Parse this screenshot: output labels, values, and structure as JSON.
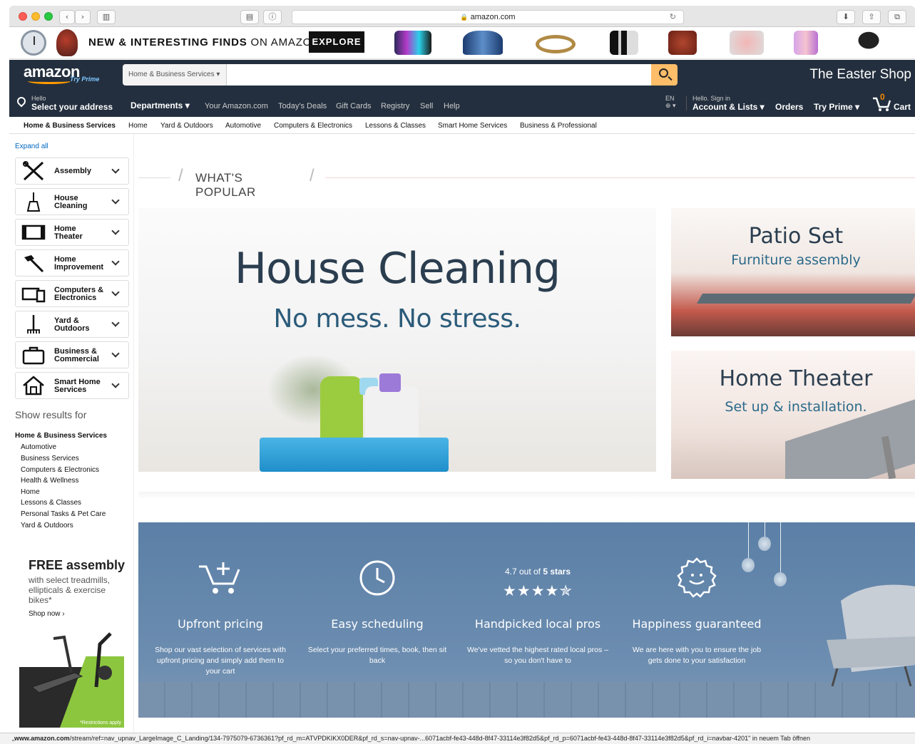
{
  "browser": {
    "url": "amazon.com",
    "lock_icon": "lock-icon",
    "status_url_host": "www.amazon.com",
    "status_url_rest": "/stream/ref=nav_upnav_LargeImage_C_Landing/134-7975079-6736361?pf_rd_m=ATVPDKIKX0DER&pf_rd_s=nav-upnav-...6071acbf-fe43-448d-8f47-33114e3f82d5&pf_rd_p=6071acbf-fe43-448d-8f47-33114e3f82d5&pf_rd_i=navbar-4201\" in neuem Tab öffnen",
    "status_prefix": "„"
  },
  "promo": {
    "text_bold": "NEW & INTERESTING FINDS",
    "text_rest": " ON AMAZON",
    "explore": "EXPLORE"
  },
  "header": {
    "logo": "amazon",
    "try_prime_small": "Try Prime",
    "search_department": "Home & Business Services ▾",
    "search_placeholder": "",
    "easter_shop": "The Easter Shop",
    "hello": "Hello",
    "select_address": "Select your address",
    "departments": "Departments ▾",
    "links": [
      "Your Amazon.com",
      "Today's Deals",
      "Gift Cards",
      "Registry",
      "Sell",
      "Help"
    ],
    "lang": "EN",
    "globe": "⊕ ▾",
    "signin_hello": "Hello. Sign in",
    "account_lists": "Account & Lists ▾",
    "orders": "Orders",
    "try_prime": "Try Prime ▾",
    "cart_count": "0",
    "cart": "Cart"
  },
  "subnav": [
    "Home & Business Services",
    "Home",
    "Yard & Outdoors",
    "Automotive",
    "Computers & Electronics",
    "Lessons & Classes",
    "Smart Home Services",
    "Business & Professional"
  ],
  "sidebar": {
    "expand_all": "Expand all",
    "categories": [
      {
        "label1": "Assembly",
        "label2": "",
        "icon": "tools-icon"
      },
      {
        "label1": "House",
        "label2": "Cleaning",
        "icon": "broom-icon"
      },
      {
        "label1": "Home",
        "label2": "Theater",
        "icon": "tv-icon"
      },
      {
        "label1": "Home",
        "label2": "Improvement",
        "icon": "hammer-icon"
      },
      {
        "label1": "Computers &",
        "label2": "Electronics",
        "icon": "devices-icon"
      },
      {
        "label1": "Yard &",
        "label2": "Outdoors",
        "icon": "rake-icon"
      },
      {
        "label1": "Business &",
        "label2": "Commercial",
        "icon": "briefcase-icon"
      },
      {
        "label1": "Smart Home",
        "label2": "Services",
        "icon": "smart-home-icon"
      }
    ],
    "show_results": "Show results for",
    "results_head": "Home & Business Services",
    "results": [
      "Automotive",
      "Business Services",
      "Computers & Electronics",
      "Health & Wellness",
      "Home",
      "Lessons & Classes",
      "Personal Tasks & Pet Care",
      "Yard & Outdoors"
    ],
    "free_title": "FREE assembly",
    "free_sub": "with select treadmills, ellipticals & exercise bikes*",
    "shop_now": "Shop now ›",
    "restrictions": "*Restrictions apply"
  },
  "main": {
    "whats_popular": "WHAT'S POPULAR",
    "hero_title": "House Cleaning",
    "hero_sub": "No mess. No stress.",
    "tiles": [
      {
        "title": "Patio Set",
        "sub": "Furniture assembly"
      },
      {
        "title": "Home Theater",
        "sub": "Set up & installation."
      }
    ],
    "features": [
      {
        "title": "Upfront pricing",
        "desc": "Shop our vast selection of services with upfront pricing and simply add them to your cart",
        "icon": "cart-add-icon"
      },
      {
        "title": "Easy scheduling",
        "desc": "Select your preferred times, book, then sit back",
        "icon": "clock-icon"
      },
      {
        "title": "Handpicked local pros",
        "desc": "We've vetted the highest rated local pros – so you don't have to",
        "icon": "stars-icon",
        "rating_pre": "4.7 out of ",
        "rating_bold": "5 stars",
        "stars": "★★★★✯"
      },
      {
        "title": "Happiness guaranteed",
        "desc": "We are here with you to ensure the job gets done to your satisfaction",
        "icon": "smile-icon"
      }
    ]
  }
}
